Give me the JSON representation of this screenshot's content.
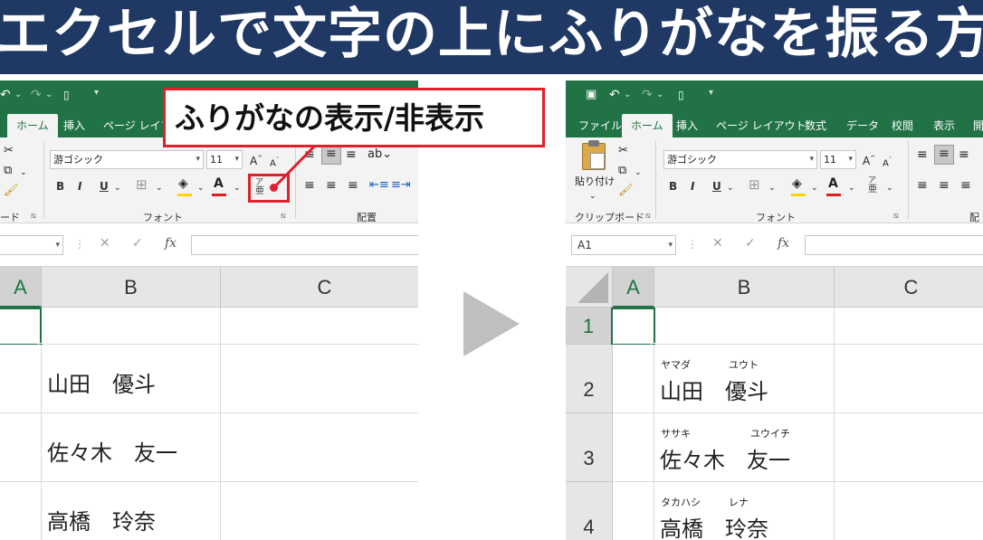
{
  "banner": {
    "title": "エクセルで文字の上にふりがなを振る方法"
  },
  "callout": {
    "text": "ふりがなの表示/非表示"
  },
  "colors": {
    "banner_bg": "#1f3864",
    "excel_green": "#217346",
    "highlight_red": "#e0202c",
    "arrow_gray": "#bfbfbf"
  },
  "left": {
    "tabs": [
      "ホーム",
      "挿入",
      "ページ レイアウト"
    ],
    "font_name": "游ゴシック",
    "font_size": "11",
    "group_font": "フォント",
    "group_align": "配置",
    "clipboard_label_fragment": "ード",
    "columns": [
      "A",
      "B",
      "C"
    ],
    "rows": [
      {
        "text": ""
      },
      {
        "text": "山田　優斗"
      },
      {
        "text": "佐々木　友一"
      },
      {
        "text": "高橋　玲奈"
      }
    ]
  },
  "right": {
    "tabs": [
      "ファイル",
      "ホーム",
      "挿入",
      "ページ レイアウト",
      "数式",
      "データ",
      "校閲",
      "表示",
      "開"
    ],
    "paste_label": "貼り付け",
    "clipboard_label": "クリップボード",
    "font_name": "游ゴシック",
    "font_size": "11",
    "group_font": "フォント",
    "group_align_fragment": "配",
    "name_box": "A1",
    "columns": [
      "A",
      "B",
      "C"
    ],
    "rows": [
      {
        "num": "1",
        "text": "",
        "furi_last": "",
        "furi_first": ""
      },
      {
        "num": "2",
        "text": "山田　優斗",
        "furi_last": "ヤマダ",
        "furi_first": "ユウト"
      },
      {
        "num": "3",
        "text": "佐々木　友一",
        "furi_last": "ササキ",
        "furi_first": "ユウイチ"
      },
      {
        "num": "4",
        "text": "高橋　玲奈",
        "furi_last": "タカハシ",
        "furi_first": "レナ"
      }
    ]
  },
  "icons": [
    "save-icon",
    "undo-icon",
    "redo-icon",
    "customize-icon",
    "cut-icon",
    "copy-icon",
    "format-painter-icon",
    "paste-icon",
    "bold-icon",
    "italic-icon",
    "underline-icon",
    "border-icon",
    "fill-color-icon",
    "font-color-icon",
    "phonetic-guide-icon",
    "increase-font-icon",
    "decrease-font-icon",
    "align-left-icon",
    "align-center-icon",
    "align-right-icon",
    "indent-icon",
    "orientation-icon",
    "cancel-icon",
    "enter-icon",
    "function-icon",
    "play-arrow-icon"
  ],
  "ribbon_glyphs": {
    "bold": "B",
    "italic": "I",
    "underline": "U",
    "fx": "fx",
    "increase_font": "A",
    "decrease_font": "A",
    "font_color": "A",
    "phonetic_top": "ア",
    "phonetic_bottom": "亜"
  }
}
